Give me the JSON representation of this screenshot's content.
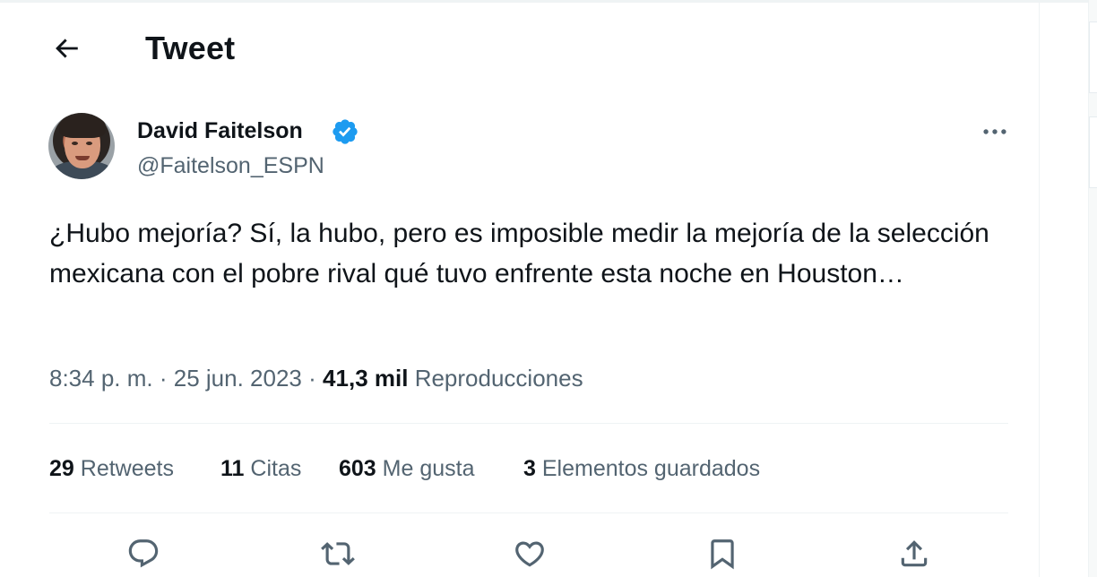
{
  "header": {
    "title": "Tweet"
  },
  "author": {
    "name": "David Faitelson",
    "handle": "@Faitelson_ESPN",
    "verified": true
  },
  "tweet": {
    "text": "¿Hubo mejoría? Sí, la hubo, pero es imposible medir la mejoría de la selección mexicana con el pobre rival qué tuvo enfrente esta noche en Houston…",
    "time": "8:34 p. m.",
    "date": "25 jun. 2023",
    "separator": "·",
    "views_count": "41,3 mil",
    "views_label": "Reproducciones"
  },
  "stats": {
    "retweets_count": "29",
    "retweets_label": "Retweets",
    "quotes_count": "11",
    "quotes_label": "Citas",
    "likes_count": "603",
    "likes_label": "Me gusta",
    "bookmarks_count": "3",
    "bookmarks_label": "Elementos guardados"
  },
  "colors": {
    "text": "#0f1419",
    "secondary": "#536471",
    "verified_blue": "#1d9bf0",
    "divider": "#eff3f4"
  },
  "icons": {
    "back": "arrow-left-icon",
    "verified": "verified-badge-icon",
    "more": "more-horizontal-icon",
    "reply": "reply-icon",
    "retweet": "retweet-icon",
    "like": "heart-icon",
    "bookmark": "bookmark-icon",
    "share": "share-icon"
  }
}
